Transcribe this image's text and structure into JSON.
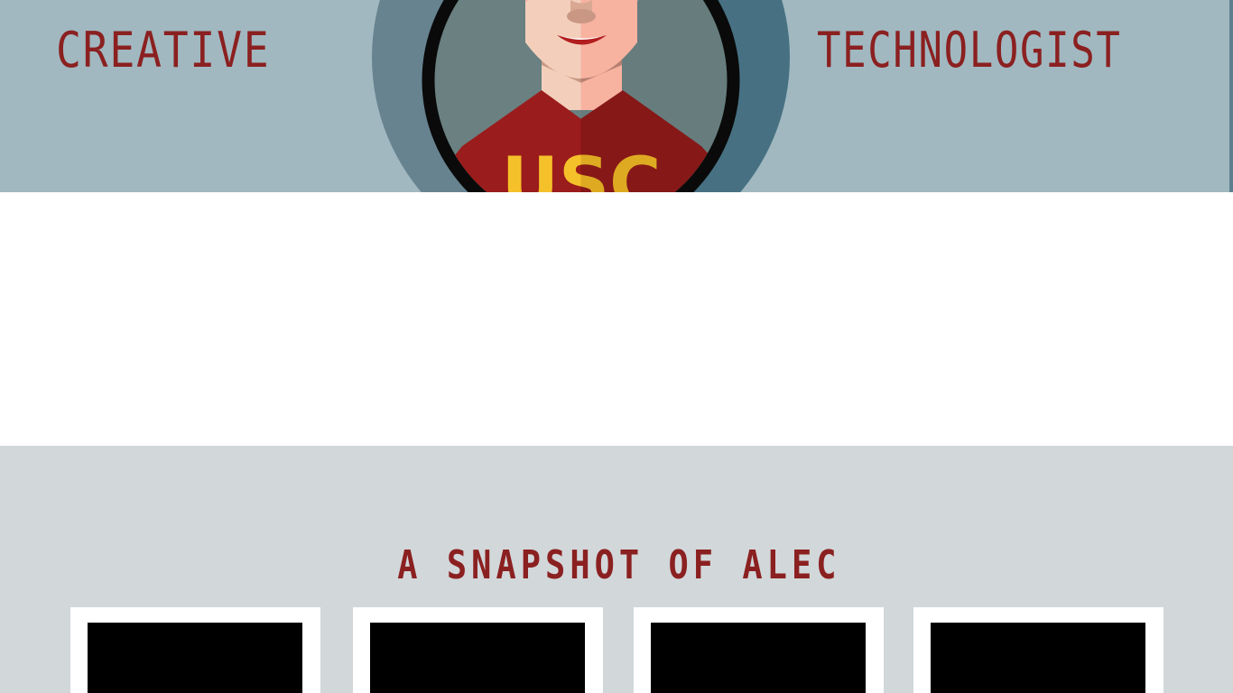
{
  "hero": {
    "left_word": "CREATIVE",
    "right_word": "TECHNOLOGIST",
    "background": "#a1b8c0",
    "text_color": "#8b2020"
  },
  "avatar": {
    "shirt_text": "USC",
    "shirt_color": "#9b1c1c",
    "letter_color": "#f5c12a"
  },
  "snapshot": {
    "title": "A SNAPSHOT OF ALEC",
    "background": "#d2d7da",
    "cards": [
      {
        "name": "snapshot-card-1"
      },
      {
        "name": "snapshot-card-2"
      },
      {
        "name": "snapshot-card-3"
      },
      {
        "name": "snapshot-card-4"
      }
    ]
  }
}
